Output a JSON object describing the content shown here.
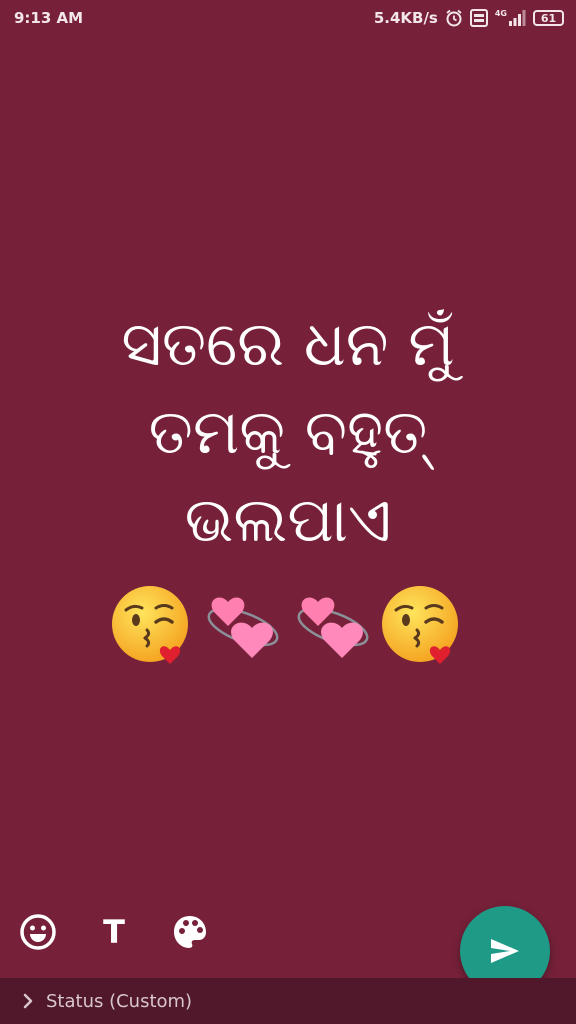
{
  "status_bar": {
    "time": "9:13 AM",
    "net_speed": "5.4KB/s",
    "network_badge": "4G",
    "battery": "61",
    "icons": [
      "alarm-icon",
      "volte-icon",
      "signal-icon",
      "battery-icon"
    ]
  },
  "status": {
    "text": "ସତରେ ଧନ ମୁଁ\nତମକୁ ବହୁତ୍\nଭଲପାଏ",
    "emojis": [
      "kissing-face-emoji",
      "revolving-hearts-emoji",
      "revolving-hearts-emoji",
      "kissing-face-emoji"
    ]
  },
  "tools": {
    "emoji_icon": "smiley-icon",
    "text_label": "T",
    "palette_icon": "palette-icon"
  },
  "send_button": {
    "icon": "send-icon"
  },
  "caption": {
    "chevron_icon": "chevron-right-icon",
    "label": "Status (Custom)"
  },
  "colors": {
    "background": "#762139",
    "fab": "#1f9a86",
    "caption_bar": "#50182a"
  }
}
